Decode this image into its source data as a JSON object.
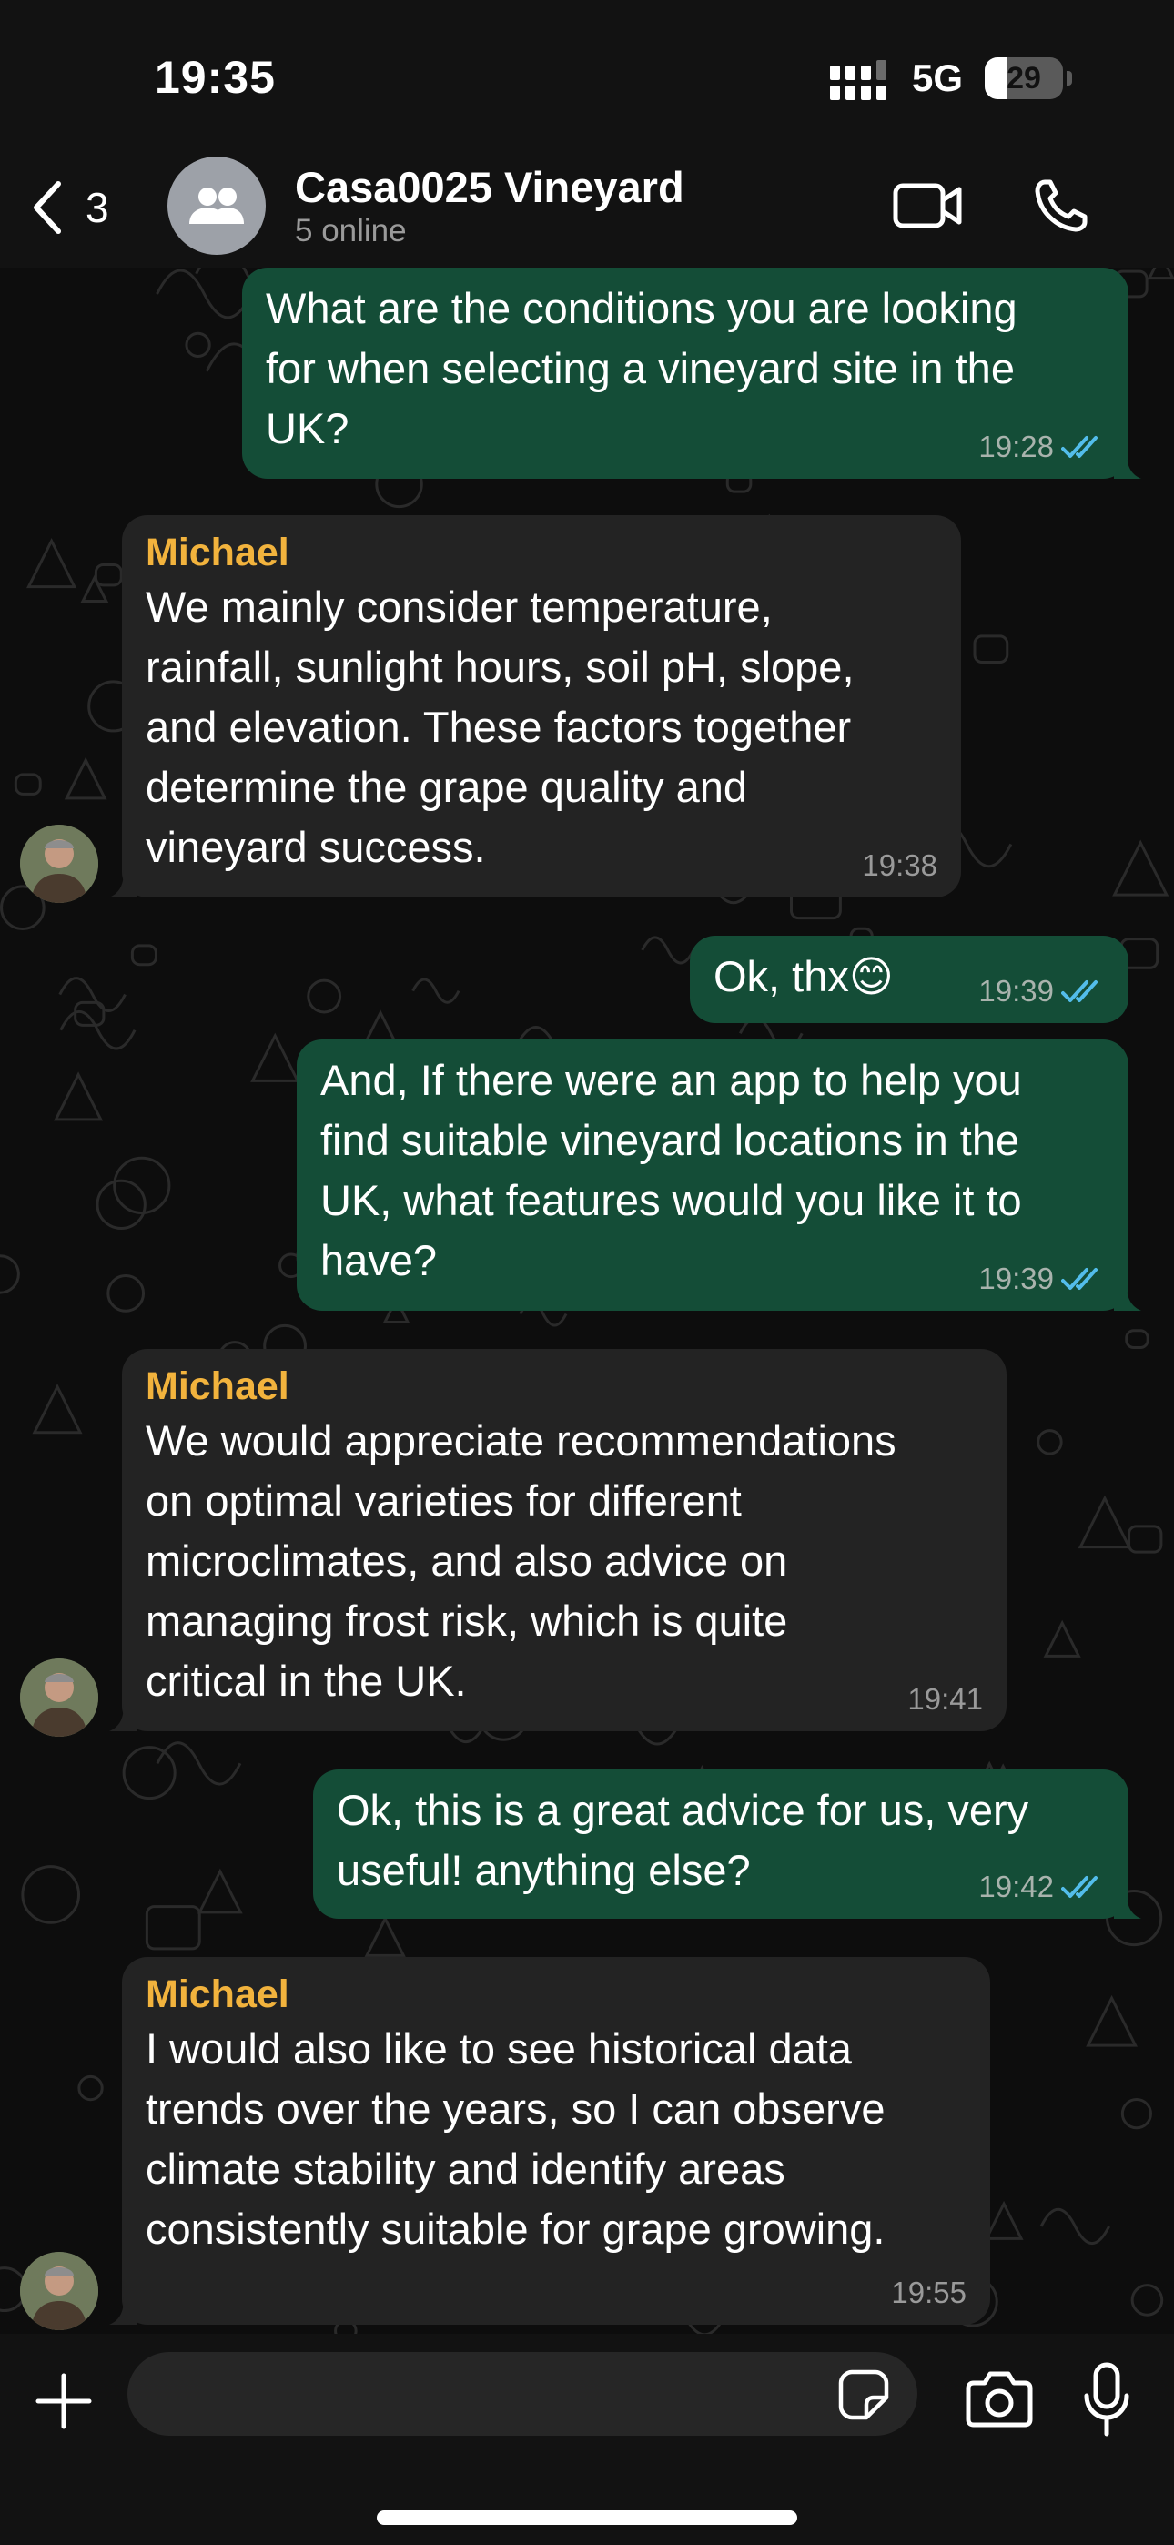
{
  "status_bar": {
    "time": "19:35",
    "network": "5G",
    "battery": "29",
    "battery_level": 0.29
  },
  "header": {
    "back_count": "3",
    "title": "Casa0025 Vineyard",
    "status": "5 online"
  },
  "messages": [
    {
      "dir": "out",
      "text": "What are the conditions you are looking\nfor when selecting a vineyard site in the\nUK?",
      "time": "19:28",
      "read": true
    },
    {
      "dir": "in",
      "sender": "Michael",
      "text": "We mainly consider temperature,\nrainfall, sunlight hours, soil pH, slope,\nand elevation. These factors together\ndetermine the grape quality and\nvineyard success.",
      "time": "19:38"
    },
    {
      "dir": "out",
      "text": "Ok, thx😊",
      "time": "19:39",
      "read": true
    },
    {
      "dir": "out",
      "text": "And, If there were an app to help you\nfind suitable vineyard locations in the\nUK, what features would you like it to\nhave?",
      "time": "19:39",
      "read": true
    },
    {
      "dir": "in",
      "sender": "Michael",
      "text": "We would appreciate recommendations\non optimal varieties for different\nmicroclimates, and also advice on\nmanaging frost risk, which is quite\ncritical in the UK.",
      "time": "19:41"
    },
    {
      "dir": "out",
      "text": "Ok, this is a great advice for us, very\nuseful! anything else?",
      "time": "19:42",
      "read": true
    },
    {
      "dir": "in",
      "sender": "Michael",
      "text": "I would also like to see historical data\ntrends over the years, so I can observe\nclimate stability and identify areas\nconsistently suitable for grape growing.",
      "time": "19:55"
    }
  ],
  "composer": {
    "placeholder": ""
  },
  "colors": {
    "outgoing_bubble": "#144d37",
    "incoming_bubble": "#232323",
    "sender_name": "#f2b33d",
    "read_ticks": "#53bdeb",
    "background": "#0d0d0d"
  },
  "icons": {
    "back": "chevron-left-icon",
    "group": "people-icon",
    "video": "video-camera-icon",
    "call": "phone-icon",
    "attach": "plus-icon",
    "sticker": "sticker-icon",
    "camera": "camera-icon",
    "mic": "microphone-icon",
    "read": "double-check-icon"
  }
}
